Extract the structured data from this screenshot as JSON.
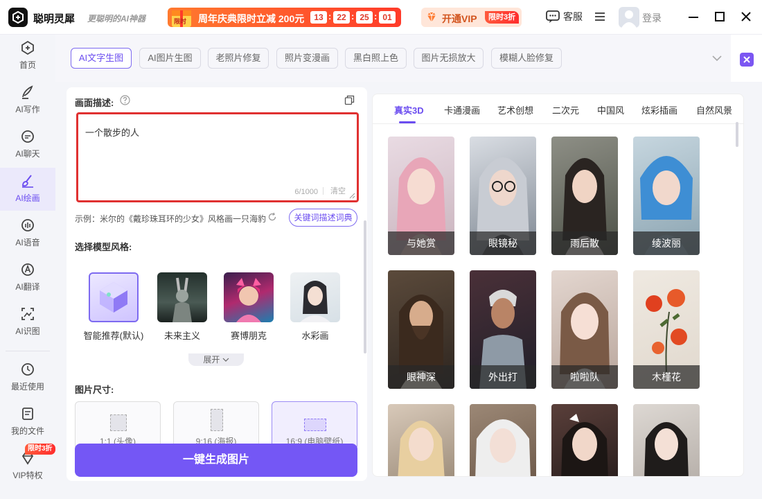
{
  "app": {
    "name": "聪明灵犀",
    "slogan": "更聪明的AI神器"
  },
  "promo": {
    "text": "周年庆典限时立减 200元",
    "countdown": [
      "13",
      "22",
      "25",
      "01"
    ],
    "separator": ":",
    "gift_word": "限时"
  },
  "vip": {
    "label": "开通VIP",
    "badge": "限时3折"
  },
  "header": {
    "service": "客服",
    "login": "登录"
  },
  "sidebar": {
    "items": [
      {
        "label": "首页",
        "icon": "home-icon"
      },
      {
        "label": "AI写作",
        "icon": "pen-icon"
      },
      {
        "label": "AI聊天",
        "icon": "chat-icon"
      },
      {
        "label": "AI绘画",
        "icon": "brush-icon",
        "active": true
      },
      {
        "label": "AI语音",
        "icon": "voice-icon"
      },
      {
        "label": "AI翻译",
        "icon": "translate-icon"
      },
      {
        "label": "AI识图",
        "icon": "image-recognize-icon"
      },
      {
        "label": "最近使用",
        "icon": "history-icon"
      },
      {
        "label": "我的文件",
        "icon": "file-icon"
      },
      {
        "label": "VIP特权",
        "icon": "diamond-icon"
      }
    ],
    "vip_badge": "限时3折"
  },
  "tabs": [
    "AI文字生图",
    "AI图片生图",
    "老照片修复",
    "照片变漫画",
    "黑白照上色",
    "图片无损放大",
    "模糊人脸修复"
  ],
  "form": {
    "desc_label": "画面描述:",
    "prompt_value": "一个散步的人",
    "char_count": "6/1000",
    "clear": "清空",
    "example_text": "示例：米尔的《戴珍珠耳环的少女》风格画一只海豹",
    "dict_button": "关键词描述词典",
    "model_label": "选择模型风格:",
    "styles": [
      "智能推荐(默认)",
      "未来主义",
      "赛博朋克",
      "水彩画"
    ],
    "expand": "展开",
    "size_label": "图片尺寸:",
    "sizes": [
      "1:1 (头像)",
      "9:16 (海报)",
      "16:9 (电脑壁纸)"
    ],
    "generate": "一键生成图片"
  },
  "categories": [
    "真实3D",
    "卡通漫画",
    "艺术创想",
    "二次元",
    "中国风",
    "炫彩插画",
    "自然风景"
  ],
  "gallery": [
    "与她赏",
    "眼镜秘",
    "雨后散",
    "绫波丽",
    "眼神深",
    "外出打",
    "啦啦队",
    "木槿花"
  ],
  "colors": {
    "accent": "#6b4df0",
    "button": "#7457f5",
    "promo": "#ff3b2a",
    "highlight": "#e03131"
  }
}
